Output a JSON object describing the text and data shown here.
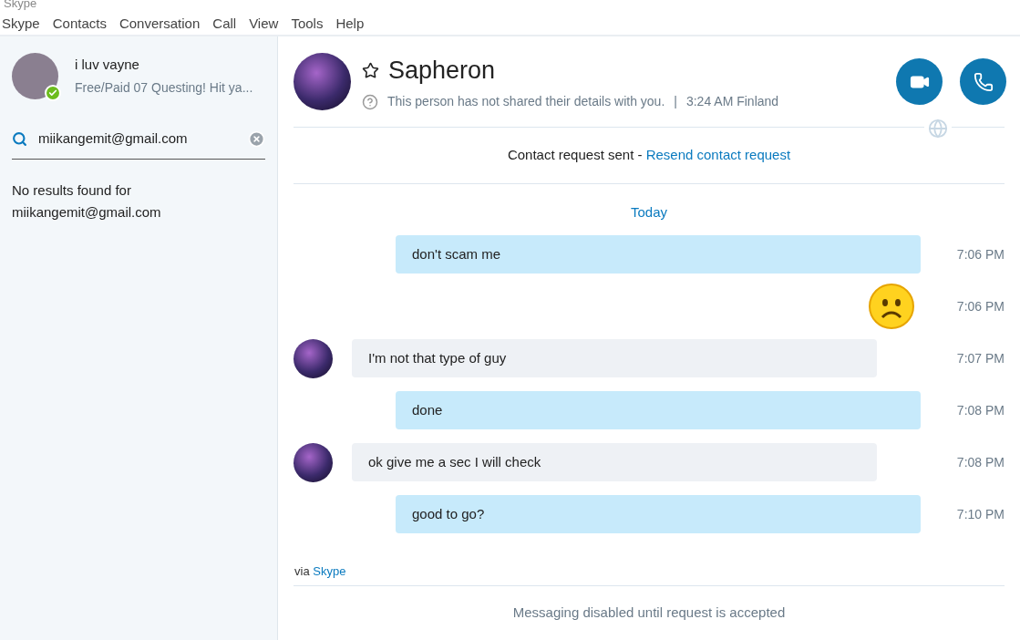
{
  "window": {
    "title": "Skype"
  },
  "menu": [
    "Skype",
    "Contacts",
    "Conversation",
    "Call",
    "View",
    "Tools",
    "Help"
  ],
  "profile": {
    "name": "i luv vayne",
    "mood": "Free/Paid 07 Questing! Hit ya...",
    "online": true
  },
  "search": {
    "value": "miikangemit@gmail.com"
  },
  "search_result": "No results found for miikangemit@gmail.com",
  "contact": {
    "name": "Sapheron",
    "favorite": false,
    "details": "This person has not shared their details with you.",
    "separator": "|",
    "local_time": "3:24 AM Finland"
  },
  "request": {
    "text": "Contact request sent - ",
    "link": "Resend contact request"
  },
  "day_label": "Today",
  "messages": [
    {
      "kind": "text",
      "outgoing": true,
      "text": "don't scam me",
      "time": "7:06 PM"
    },
    {
      "kind": "emoji",
      "outgoing": true,
      "time": "7:06 PM"
    },
    {
      "kind": "text",
      "outgoing": false,
      "text": "I'm not that type of guy",
      "time": "7:07 PM"
    },
    {
      "kind": "text",
      "outgoing": true,
      "text": "done",
      "time": "7:08 PM"
    },
    {
      "kind": "text",
      "outgoing": false,
      "text": "ok give me a sec I will check",
      "time": "7:08 PM"
    },
    {
      "kind": "text",
      "outgoing": true,
      "text": "good to go?",
      "time": "7:10 PM"
    }
  ],
  "via": {
    "text": "via",
    "link": "Skype"
  },
  "composer_notice": "Messaging disabled until request is accepted"
}
